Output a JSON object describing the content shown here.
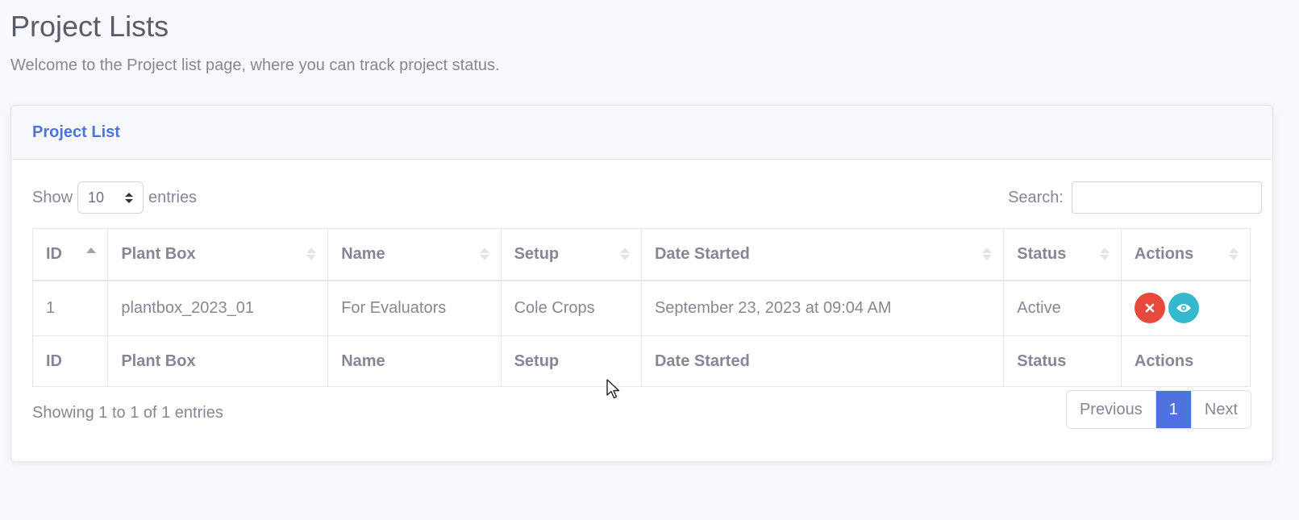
{
  "page": {
    "title": "Project Lists",
    "subtitle": "Welcome to the Project list page, where you can track project status."
  },
  "card": {
    "title": "Project List"
  },
  "controls": {
    "show_label": "Show",
    "length_value": "10",
    "entries_label": "entries",
    "search_label": "Search:",
    "search_value": ""
  },
  "table": {
    "columns": [
      "ID",
      "Plant Box",
      "Name",
      "Setup",
      "Date Started",
      "Status",
      "Actions"
    ],
    "rows": [
      {
        "id": "1",
        "plant_box": "plantbox_2023_01",
        "name": "For Evaluators",
        "setup": "Cole Crops",
        "date_started": "September 23, 2023 at 09:04 AM",
        "status": "Active",
        "actions": [
          "delete-icon",
          "eye-icon"
        ]
      }
    ]
  },
  "footer": {
    "info": "Showing 1 to 1 of 1 entries",
    "previous": "Previous",
    "page": "1",
    "next": "Next"
  },
  "colors": {
    "primary": "#4e73df",
    "danger": "#e74a3b",
    "info": "#36b9cc",
    "text": "#858796"
  }
}
